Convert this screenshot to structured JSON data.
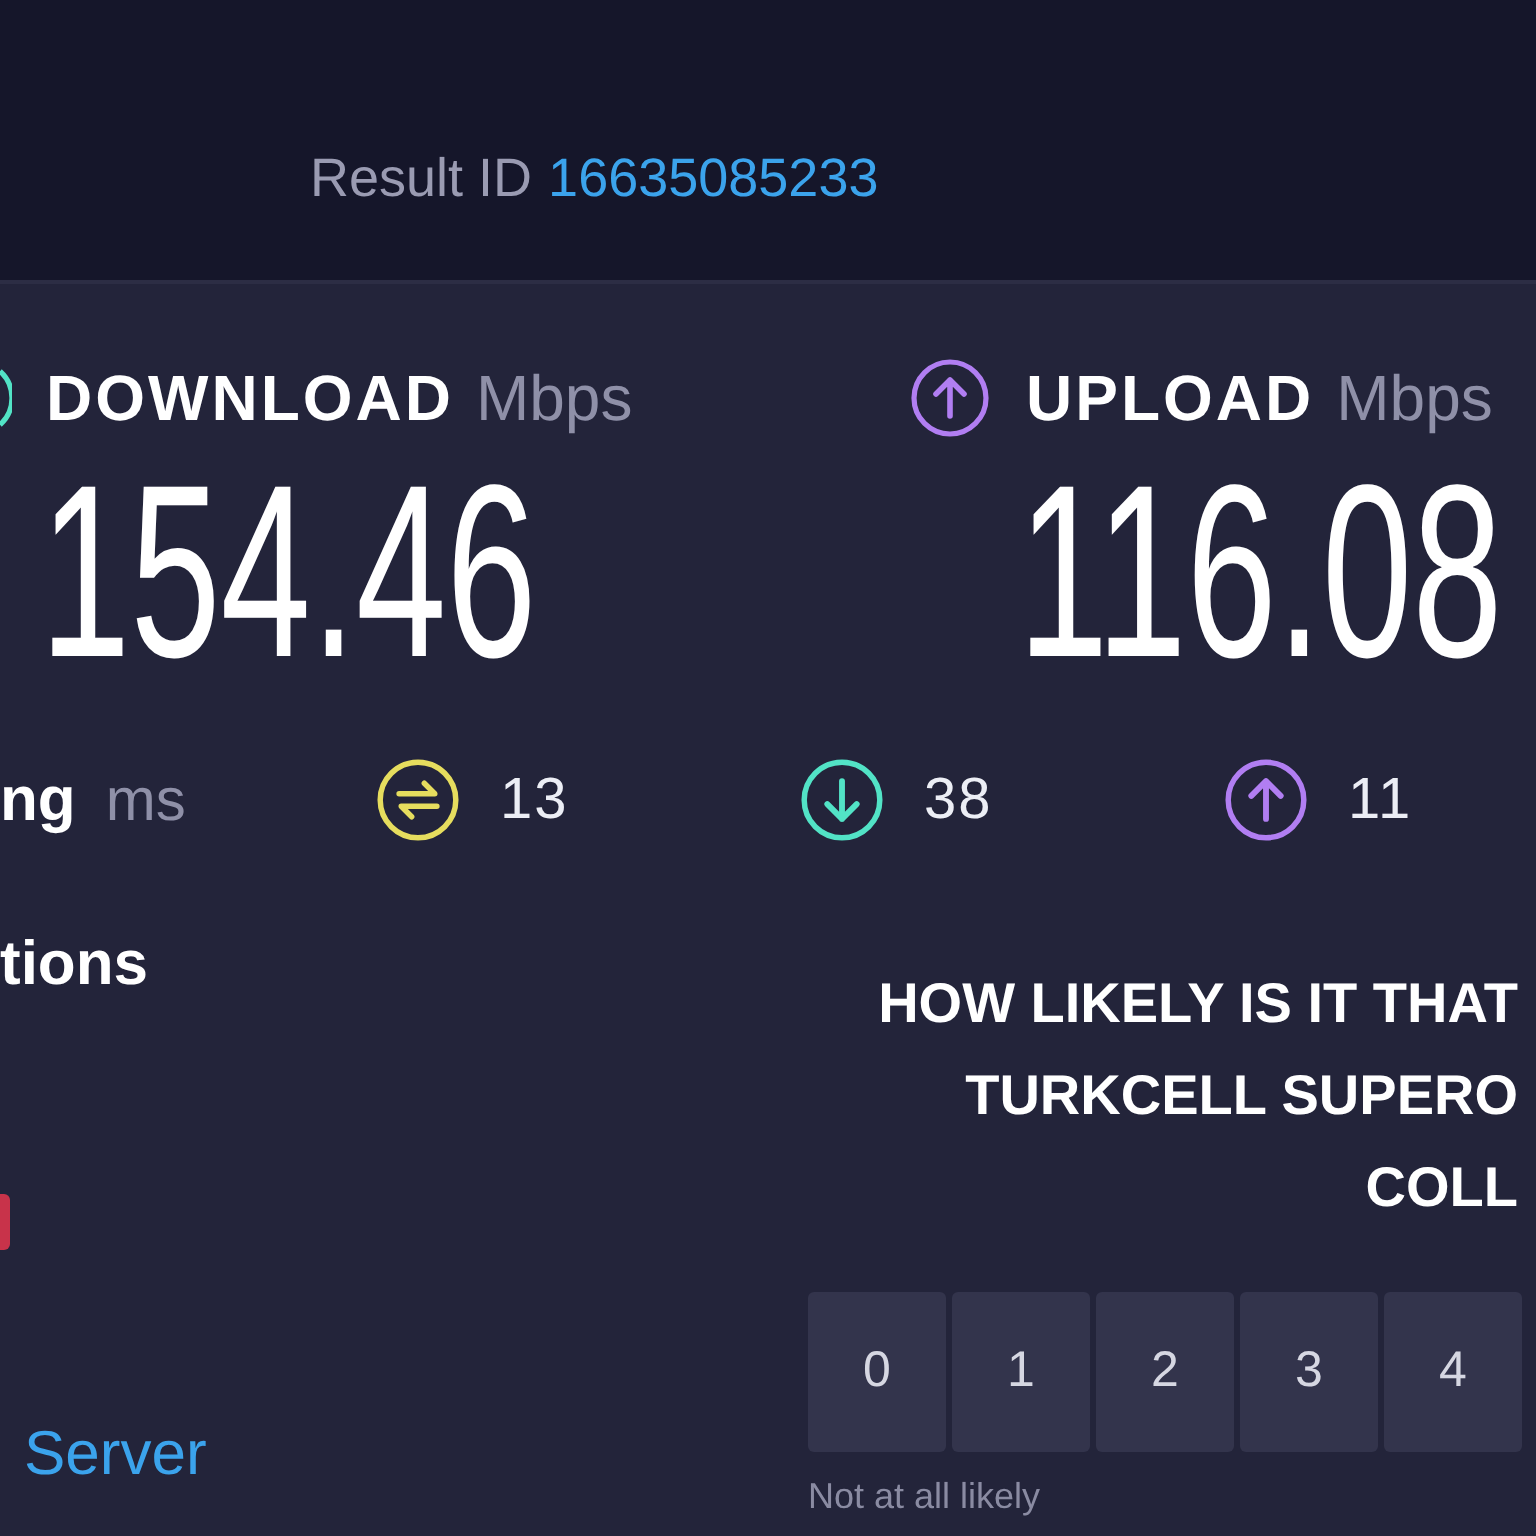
{
  "header": {
    "result_label": "Result ID",
    "result_id": "16635085233"
  },
  "speeds": [
    {
      "kind": "download",
      "label": "DOWNLOAD",
      "unit": "Mbps",
      "value": "154.46"
    },
    {
      "kind": "upload",
      "label": "UPLOAD",
      "unit": "Mbps",
      "value": "116.08"
    }
  ],
  "ping": {
    "label": "ng",
    "unit": "ms",
    "stats": [
      {
        "kind": "idle",
        "value": "13"
      },
      {
        "kind": "download",
        "value": "38"
      },
      {
        "kind": "upload",
        "value": "11"
      }
    ]
  },
  "connections": {
    "title": "tions",
    "link": "Server"
  },
  "survey": {
    "question_lines": [
      "HOW LIKELY IS IT THAT",
      "TURKCELL SUPERO",
      "COLL"
    ],
    "scale": [
      "0",
      "1",
      "2",
      "3",
      "4"
    ],
    "low_label": "Not at all likely"
  }
}
